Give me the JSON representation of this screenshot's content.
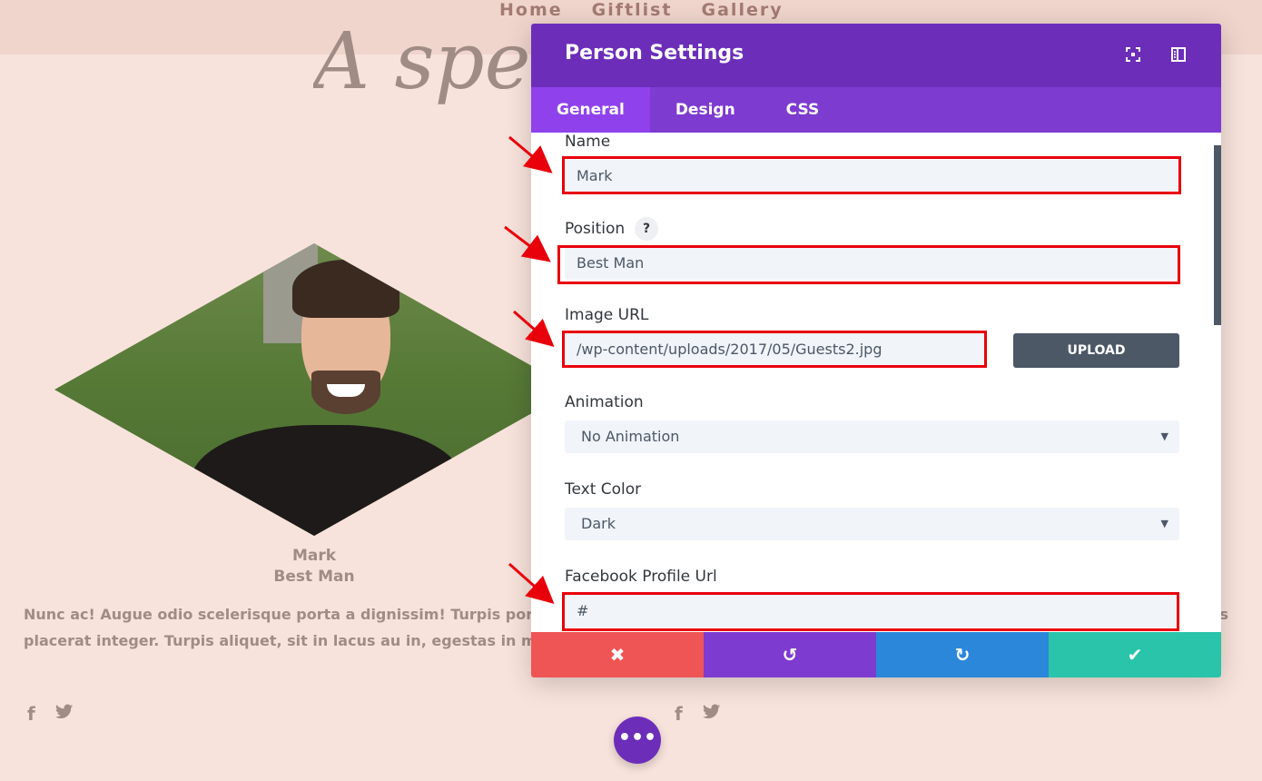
{
  "nav": {
    "items": [
      "Home",
      "Giftlist",
      "Gallery"
    ]
  },
  "page": {
    "title_fragment": "A spec",
    "person": {
      "name": "Mark",
      "position": "Best Man"
    },
    "bio": "Nunc ac! Augue odio scelerisque porta a dignissim! Turpis porta massa ultrices aliquam nisi, etiam in porttitor augue dis. Et in dictumst velit, eros placerat integer. Turpis aliquet, sit in lacus au in, egestas in mid.",
    "social": {
      "facebook": "f",
      "twitter": "t"
    }
  },
  "modal": {
    "title": "Person Settings",
    "tabs": [
      "General",
      "Design",
      "CSS"
    ],
    "active_tab": "General",
    "fields": {
      "name_label": "Name",
      "name_value": "Mark",
      "position_label": "Position",
      "position_value": "Best Man",
      "help_glyph": "?",
      "image_url_label": "Image URL",
      "image_url_value": "/wp-content/uploads/2017/05/Guests2.jpg",
      "upload_label": "UPLOAD",
      "animation_label": "Animation",
      "animation_value": "No Animation",
      "text_color_label": "Text Color",
      "text_color_value": "Dark",
      "facebook_label": "Facebook Profile Url",
      "facebook_value": "#"
    },
    "footer": {
      "cancel": "✖",
      "undo": "↺",
      "redo": "↻",
      "save": "✔"
    }
  },
  "colors": {
    "accent": "#6c2eb9",
    "highlight": "#e8000b",
    "cancel": "#ef5555",
    "redo": "#2b87da",
    "save": "#29c4a9"
  },
  "fab_label": "•••"
}
